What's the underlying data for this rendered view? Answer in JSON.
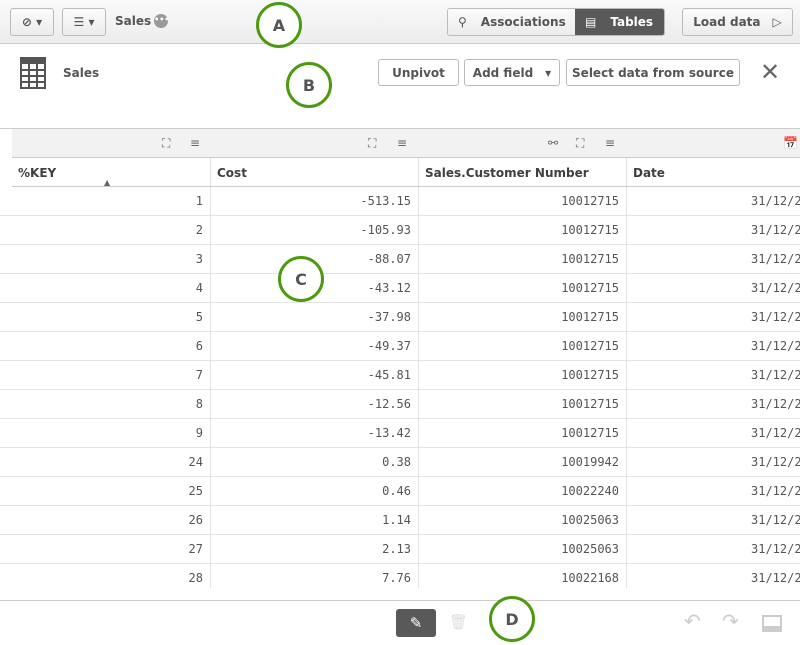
{
  "topbar": {
    "app_title": "Sales",
    "assoc_label": "Associations",
    "tables_label": "Tables",
    "load_label": "Load data"
  },
  "toolbar": {
    "table_name": "Sales",
    "unpivot": "Unpivot",
    "add_field": "Add field",
    "select_source": "Select data from source"
  },
  "table": {
    "columns": [
      "%KEY",
      "Cost",
      "Sales.Customer Number",
      "Date"
    ],
    "rows": [
      [
        "1",
        "-513.15",
        "10012715",
        "31/12/2"
      ],
      [
        "2",
        "-105.93",
        "10012715",
        "31/12/2"
      ],
      [
        "3",
        "-88.07",
        "10012715",
        "31/12/2"
      ],
      [
        "4",
        "-43.12",
        "10012715",
        "31/12/2"
      ],
      [
        "5",
        "-37.98",
        "10012715",
        "31/12/2"
      ],
      [
        "6",
        "-49.37",
        "10012715",
        "31/12/2"
      ],
      [
        "7",
        "-45.81",
        "10012715",
        "31/12/2"
      ],
      [
        "8",
        "-12.56",
        "10012715",
        "31/12/2"
      ],
      [
        "9",
        "-13.42",
        "10012715",
        "31/12/2"
      ],
      [
        "24",
        "0.38",
        "10019942",
        "31/12/2"
      ],
      [
        "25",
        "0.46",
        "10022240",
        "31/12/2"
      ],
      [
        "26",
        "1.14",
        "10025063",
        "31/12/2"
      ],
      [
        "27",
        "2.13",
        "10025063",
        "31/12/2"
      ],
      [
        "28",
        "7.76",
        "10022168",
        "31/12/2"
      ]
    ]
  },
  "callouts": {
    "a": "A",
    "b": "B",
    "c": "C",
    "d": "D"
  },
  "colors": {
    "callout": "#4b9a0f",
    "active": "#595959"
  }
}
